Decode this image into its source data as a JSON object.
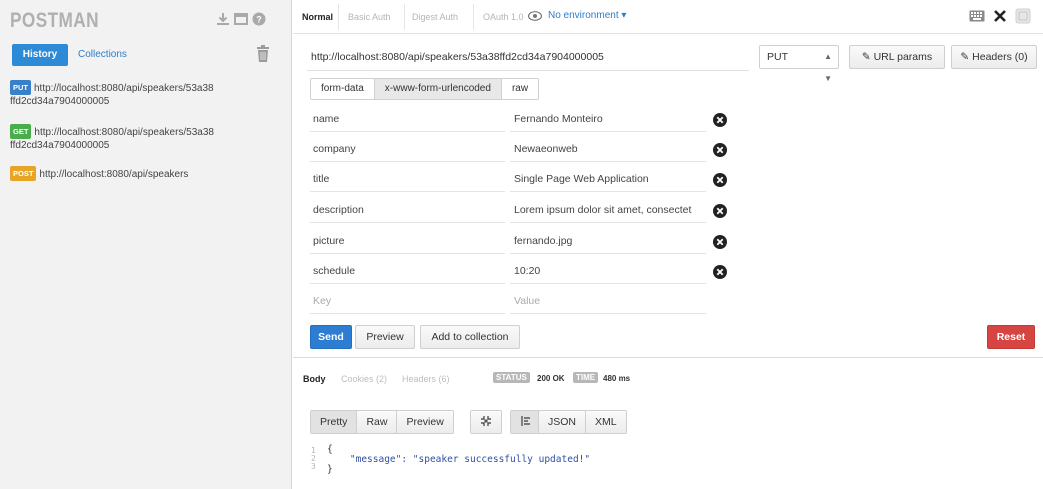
{
  "sidebar": {
    "logo": "POSTMAN",
    "tabs": {
      "history": "History",
      "collections": "Collections"
    },
    "history": [
      {
        "method": "PUT",
        "url_line1": "http://localhost:8080/api/speakers/53a38",
        "url_line2": "ffd2cd34a7904000005"
      },
      {
        "method": "GET",
        "url_line1": "http://localhost:8080/api/speakers/53a38",
        "url_line2": "ffd2cd34a7904000005"
      },
      {
        "method": "POST",
        "url_line1": "http://localhost:8080/api/speakers",
        "url_line2": ""
      }
    ]
  },
  "auth_tabs": [
    "Normal",
    "Basic Auth",
    "Digest Auth",
    "OAuth 1.0"
  ],
  "environment": "No environment",
  "request": {
    "url": "http://localhost:8080/api/speakers/53a38ffd2cd34a7904000005",
    "method": "PUT",
    "url_params_label": "URL params",
    "headers_label": "Headers (0)"
  },
  "body_tabs": [
    "form-data",
    "x-www-form-urlencoded",
    "raw"
  ],
  "params": [
    {
      "key": "name",
      "value": "Fernando Monteiro"
    },
    {
      "key": "company",
      "value": "Newaeonweb"
    },
    {
      "key": "title",
      "value": "Single Page Web Application"
    },
    {
      "key": "description",
      "value": "Lorem ipsum dolor sit amet, consectet"
    },
    {
      "key": "picture",
      "value": "fernando.jpg"
    },
    {
      "key": "schedule",
      "value": "10:20"
    }
  ],
  "placeholders": {
    "key": "Key",
    "value": "Value"
  },
  "actions": {
    "send": "Send",
    "preview": "Preview",
    "add_to_collection": "Add to collection",
    "reset": "Reset"
  },
  "response": {
    "tabs": [
      "Body",
      "Cookies (2)",
      "Headers (6)"
    ],
    "status_label": "STATUS",
    "status_value": "200 OK",
    "time_label": "TIME",
    "time_value": "480 ms",
    "views": [
      "Pretty",
      "Raw",
      "Preview"
    ],
    "formats": [
      "JSON",
      "XML"
    ],
    "code_lines": [
      "{",
      "    \"message\": \"speaker successfully updated!\"",
      "}"
    ],
    "line_numbers": [
      "1",
      "2",
      "3"
    ]
  },
  "colors": {
    "primary": "#2d7dd2",
    "danger": "#d64541",
    "put": "#3a80c9",
    "get": "#49ad4b",
    "post": "#e7a528"
  }
}
